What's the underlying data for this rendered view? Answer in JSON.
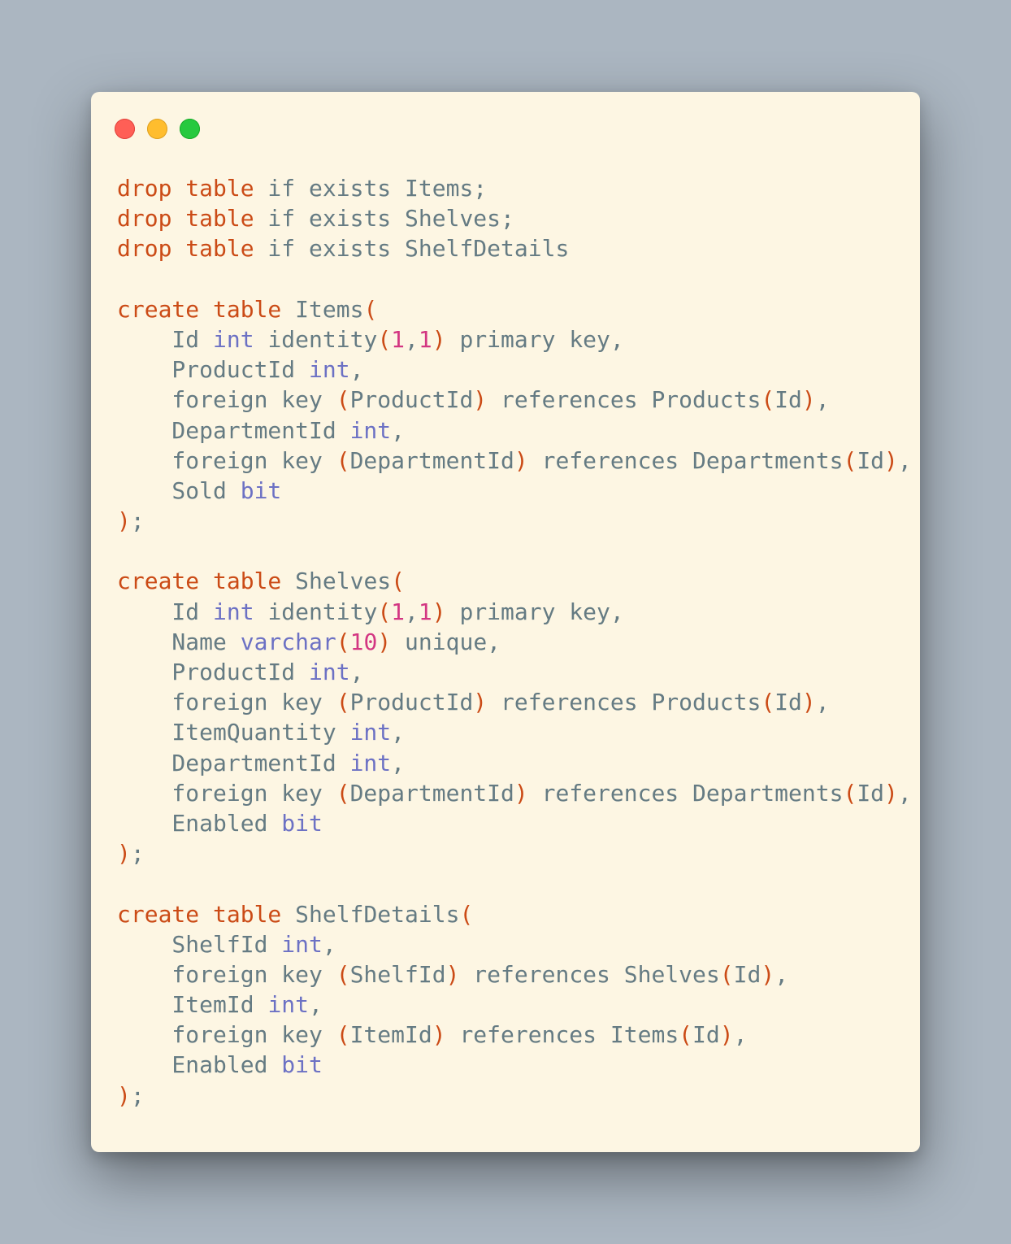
{
  "window": {
    "controls": {
      "close_color": "#ff5f56",
      "minimize_color": "#ffbd2e",
      "maximize_color": "#27c93f"
    }
  },
  "theme": {
    "background": "#fdf6e3",
    "text": "#657b83",
    "keyword": "#cb4b16",
    "type": "#6c71c4",
    "number": "#d33682",
    "page_background": "#abb6c1"
  },
  "editor": {
    "language": "sql",
    "lines": [
      [
        [
          "kw",
          "drop table"
        ],
        [
          "id",
          " if exists Items;"
        ]
      ],
      [
        [
          "kw",
          "drop table"
        ],
        [
          "id",
          " if exists Shelves;"
        ]
      ],
      [
        [
          "kw",
          "drop table"
        ],
        [
          "id",
          " if exists ShelfDetails"
        ]
      ],
      [],
      [
        [
          "kw",
          "create table"
        ],
        [
          "id",
          " Items"
        ],
        [
          "punc",
          "("
        ]
      ],
      [
        [
          "id",
          "    Id "
        ],
        [
          "type",
          "int"
        ],
        [
          "id",
          " identity"
        ],
        [
          "punc",
          "("
        ],
        [
          "num",
          "1"
        ],
        [
          "id",
          ","
        ],
        [
          "num",
          "1"
        ],
        [
          "punc",
          ")"
        ],
        [
          "id",
          " primary key,"
        ]
      ],
      [
        [
          "id",
          "    ProductId "
        ],
        [
          "type",
          "int"
        ],
        [
          "id",
          ","
        ]
      ],
      [
        [
          "id",
          "    foreign key "
        ],
        [
          "punc",
          "("
        ],
        [
          "id",
          "ProductId"
        ],
        [
          "punc",
          ")"
        ],
        [
          "id",
          " references Products"
        ],
        [
          "punc",
          "("
        ],
        [
          "id",
          "Id"
        ],
        [
          "punc",
          ")"
        ],
        [
          "id",
          ","
        ]
      ],
      [
        [
          "id",
          "    DepartmentId "
        ],
        [
          "type",
          "int"
        ],
        [
          "id",
          ","
        ]
      ],
      [
        [
          "id",
          "    foreign key "
        ],
        [
          "punc",
          "("
        ],
        [
          "id",
          "DepartmentId"
        ],
        [
          "punc",
          ")"
        ],
        [
          "id",
          " references Departments"
        ],
        [
          "punc",
          "("
        ],
        [
          "id",
          "Id"
        ],
        [
          "punc",
          ")"
        ],
        [
          "id",
          ","
        ]
      ],
      [
        [
          "id",
          "    Sold "
        ],
        [
          "type",
          "bit"
        ]
      ],
      [
        [
          "punc",
          ")"
        ],
        [
          "id",
          ";"
        ]
      ],
      [],
      [
        [
          "kw",
          "create table"
        ],
        [
          "id",
          " Shelves"
        ],
        [
          "punc",
          "("
        ]
      ],
      [
        [
          "id",
          "    Id "
        ],
        [
          "type",
          "int"
        ],
        [
          "id",
          " identity"
        ],
        [
          "punc",
          "("
        ],
        [
          "num",
          "1"
        ],
        [
          "id",
          ","
        ],
        [
          "num",
          "1"
        ],
        [
          "punc",
          ")"
        ],
        [
          "id",
          " primary key,"
        ]
      ],
      [
        [
          "id",
          "    Name "
        ],
        [
          "type",
          "varchar"
        ],
        [
          "punc",
          "("
        ],
        [
          "num",
          "10"
        ],
        [
          "punc",
          ")"
        ],
        [
          "id",
          " unique,"
        ]
      ],
      [
        [
          "id",
          "    ProductId "
        ],
        [
          "type",
          "int"
        ],
        [
          "id",
          ","
        ]
      ],
      [
        [
          "id",
          "    foreign key "
        ],
        [
          "punc",
          "("
        ],
        [
          "id",
          "ProductId"
        ],
        [
          "punc",
          ")"
        ],
        [
          "id",
          " references Products"
        ],
        [
          "punc",
          "("
        ],
        [
          "id",
          "Id"
        ],
        [
          "punc",
          ")"
        ],
        [
          "id",
          ","
        ]
      ],
      [
        [
          "id",
          "    ItemQuantity "
        ],
        [
          "type",
          "int"
        ],
        [
          "id",
          ","
        ]
      ],
      [
        [
          "id",
          "    DepartmentId "
        ],
        [
          "type",
          "int"
        ],
        [
          "id",
          ","
        ]
      ],
      [
        [
          "id",
          "    foreign key "
        ],
        [
          "punc",
          "("
        ],
        [
          "id",
          "DepartmentId"
        ],
        [
          "punc",
          ")"
        ],
        [
          "id",
          " references Departments"
        ],
        [
          "punc",
          "("
        ],
        [
          "id",
          "Id"
        ],
        [
          "punc",
          ")"
        ],
        [
          "id",
          ","
        ]
      ],
      [
        [
          "id",
          "    Enabled "
        ],
        [
          "type",
          "bit"
        ]
      ],
      [
        [
          "punc",
          ")"
        ],
        [
          "id",
          ";"
        ]
      ],
      [],
      [
        [
          "kw",
          "create table"
        ],
        [
          "id",
          " ShelfDetails"
        ],
        [
          "punc",
          "("
        ]
      ],
      [
        [
          "id",
          "    ShelfId "
        ],
        [
          "type",
          "int"
        ],
        [
          "id",
          ","
        ]
      ],
      [
        [
          "id",
          "    foreign key "
        ],
        [
          "punc",
          "("
        ],
        [
          "id",
          "ShelfId"
        ],
        [
          "punc",
          ")"
        ],
        [
          "id",
          " references Shelves"
        ],
        [
          "punc",
          "("
        ],
        [
          "id",
          "Id"
        ],
        [
          "punc",
          ")"
        ],
        [
          "id",
          ","
        ]
      ],
      [
        [
          "id",
          "    ItemId "
        ],
        [
          "type",
          "int"
        ],
        [
          "id",
          ","
        ]
      ],
      [
        [
          "id",
          "    foreign key "
        ],
        [
          "punc",
          "("
        ],
        [
          "id",
          "ItemId"
        ],
        [
          "punc",
          ")"
        ],
        [
          "id",
          " references Items"
        ],
        [
          "punc",
          "("
        ],
        [
          "id",
          "Id"
        ],
        [
          "punc",
          ")"
        ],
        [
          "id",
          ","
        ]
      ],
      [
        [
          "id",
          "    Enabled "
        ],
        [
          "type",
          "bit"
        ]
      ],
      [
        [
          "punc",
          ")"
        ],
        [
          "id",
          ";"
        ]
      ]
    ]
  }
}
